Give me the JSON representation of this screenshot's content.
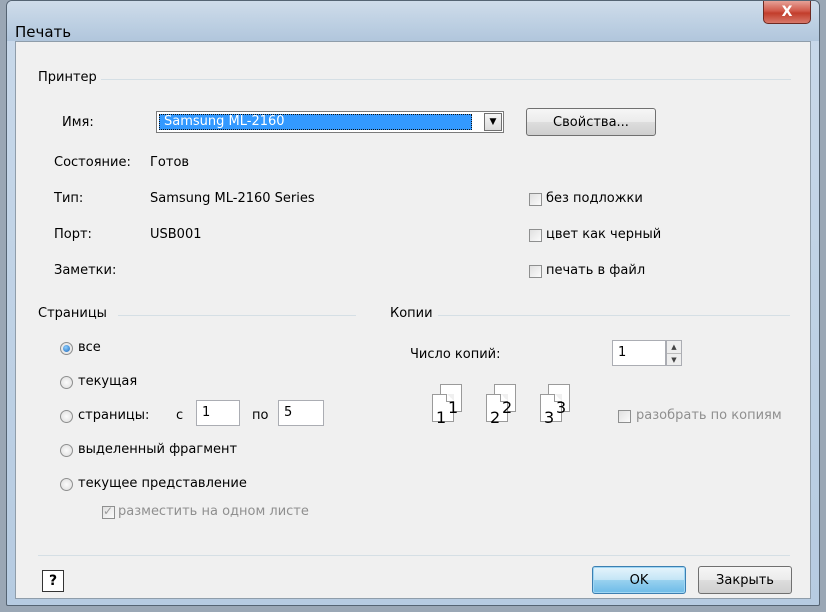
{
  "window": {
    "title": "Печать",
    "close_glyph": "X"
  },
  "printer": {
    "group_label": "Принтер",
    "name_label": "Имя:",
    "name_value": "Samsung ML-2160",
    "properties_button": "Свойства...",
    "status_label": "Состояние:",
    "status_value": "Готов",
    "type_label": "Тип:",
    "type_value": "Samsung ML-2160 Series",
    "port_label": "Порт:",
    "port_value": "USB001",
    "notes_label": "Заметки:",
    "options": [
      {
        "label": "без подложки",
        "checked": false
      },
      {
        "label": "цвет как черный",
        "checked": false
      },
      {
        "label": "печать в файл",
        "checked": false
      }
    ]
  },
  "pages": {
    "group_label": "Страницы",
    "all_label": "все",
    "current_label": "текущая",
    "range_label": "страницы:",
    "from_label": "с",
    "from_value": "1",
    "to_label": "по",
    "to_value": "5",
    "selection_label": "выделенный фрагмент",
    "current_view_label": "текущее представление",
    "fit_one_sheet_label": "разместить на одном листе",
    "selected_option": "все"
  },
  "copies": {
    "group_label": "Копии",
    "count_label": "Число копий:",
    "count_value": "1",
    "collate_label": "разобрать по копиям",
    "collate_checked": false,
    "collate_icon_numbers": [
      "1",
      "1",
      "2",
      "2",
      "3",
      "3"
    ]
  },
  "footer": {
    "help_glyph": "?",
    "ok_button": "OK",
    "close_button": "Закрыть"
  }
}
